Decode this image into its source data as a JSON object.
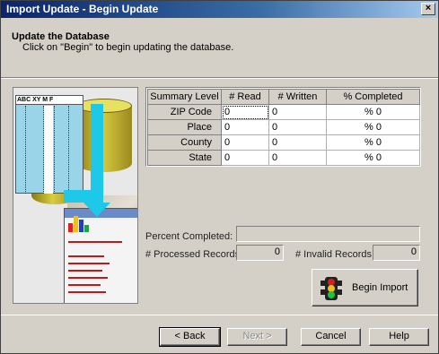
{
  "window": {
    "title": "Import Update - Begin Update",
    "close_glyph": "×"
  },
  "header": {
    "title": "Update the Database",
    "subtitle": "Click on \"Begin\" to begin updating the database."
  },
  "picture": {
    "sheet_header": "ABC XY  M  F"
  },
  "grid": {
    "columns": [
      "Summary Level",
      "# Read",
      "# Written",
      "% Completed"
    ],
    "rows": [
      {
        "level": "ZIP Code",
        "read": "0",
        "written": "0",
        "completed": "% 0"
      },
      {
        "level": "Place",
        "read": "0",
        "written": "0",
        "completed": "% 0"
      },
      {
        "level": "County",
        "read": "0",
        "written": "0",
        "completed": "% 0"
      },
      {
        "level": "State",
        "read": "0",
        "written": "0",
        "completed": "% 0"
      }
    ]
  },
  "progress": {
    "percent_label": "Percent Completed:",
    "processed_label": "# Processed Records:",
    "processed_value": "0",
    "invalid_label": "# Invalid Records:",
    "invalid_value": "0"
  },
  "begin_import": {
    "label": "Begin Import",
    "icon": "traffic-light-icon"
  },
  "footer": {
    "back": "< Back",
    "next": "Next >",
    "cancel": "Cancel",
    "help": "Help"
  },
  "colors": {
    "title_gradient_start": "#0a246a",
    "title_gradient_end": "#a6caf0",
    "face": "#d4d0c8"
  }
}
